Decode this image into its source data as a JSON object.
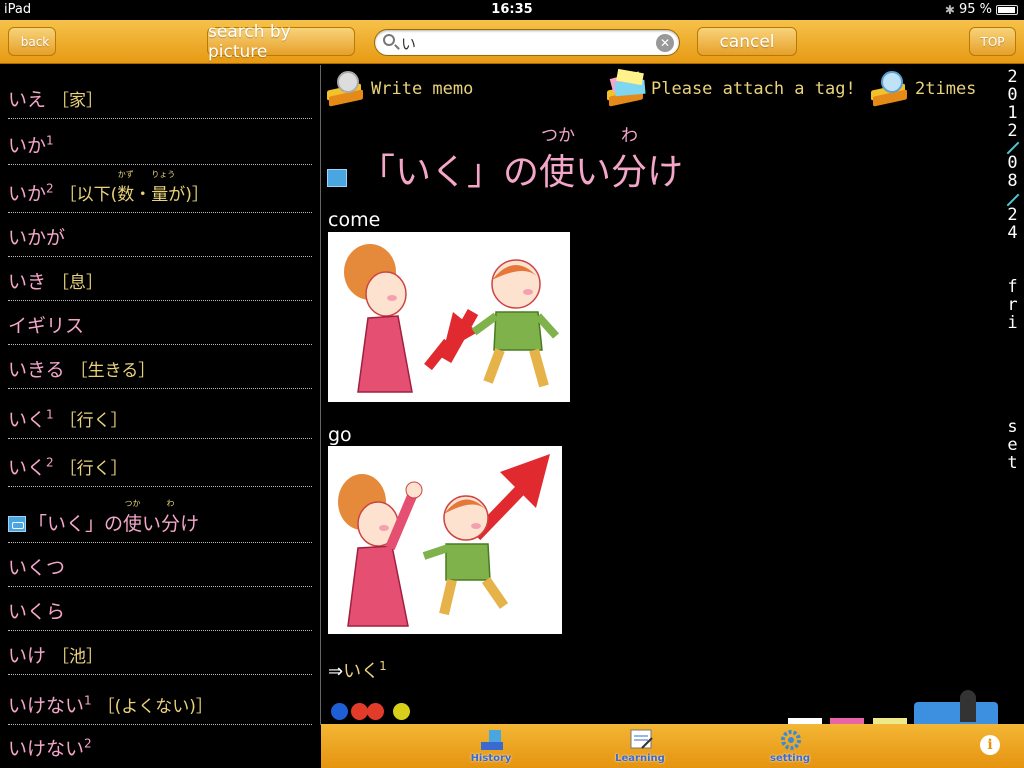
{
  "status_bar": {
    "carrier": "iPad",
    "time": "16:35",
    "battery": "95 %",
    "battery_level": 0.95
  },
  "toolbar": {
    "back_label": "back",
    "search_by_picture_label": "search by picture",
    "search_value": "い",
    "cancel_label": "cancel",
    "top_label": "TOP"
  },
  "word_list": [
    {
      "word": "いえ",
      "sup": "",
      "kanji": "［家］"
    },
    {
      "word": "いか",
      "sup": "1",
      "kanji": ""
    },
    {
      "word": "いか",
      "sup": "2",
      "kanji_pre": "［以下(",
      "kanji_ruby1_base": "数",
      "kanji_ruby1_rt": "かず",
      "kanji_mid": "・",
      "kanji_ruby2_base": "量",
      "kanji_ruby2_rt": "りょう",
      "kanji_post": "が)］"
    },
    {
      "word": "いかが",
      "sup": "",
      "kanji": ""
    },
    {
      "word": "いき",
      "sup": "",
      "kanji": "［息］"
    },
    {
      "word": "イギリス",
      "sup": "",
      "kanji": ""
    },
    {
      "word": "いきる",
      "sup": "",
      "kanji": "［生きる］"
    },
    {
      "word": "いく",
      "sup": "1",
      "kanji": "［行く］"
    },
    {
      "word": "いく",
      "sup": "2",
      "kanji": "［行く］"
    },
    {
      "word_pre": "「いく」の",
      "ruby1_base": "使",
      "ruby1_rt": "つか",
      "word_mid": "い",
      "ruby2_base": "分",
      "ruby2_rt": "わ",
      "word_post": "け"
    },
    {
      "word": "いくつ",
      "sup": "",
      "kanji": ""
    },
    {
      "word": "いくら",
      "sup": "",
      "kanji": ""
    },
    {
      "word": "いけ",
      "sup": "",
      "kanji": "［池］"
    },
    {
      "word": "いけない",
      "sup": "1",
      "kanji": "［(よくない)］"
    },
    {
      "word": "いけない",
      "sup": "2",
      "kanji": ""
    }
  ],
  "detail": {
    "write_memo_label": "Write memo",
    "attach_tag_label": "Please attach a tag!",
    "times_label": "2times",
    "title_pre": "「いく」の",
    "title_ruby1_base": "使",
    "title_ruby1_rt": "つか",
    "title_mid": "い",
    "title_ruby2_base": "分",
    "title_ruby2_rt": "わ",
    "title_post": "け",
    "sense1_label": "come",
    "sense2_label": "go",
    "cross_ref_arrow": "⇒",
    "cross_ref_word": "いく",
    "cross_ref_sup": "1",
    "dot_colors": [
      "#1f5fd6",
      "#e23b2a",
      "#e23b2a",
      "#d8cf1a"
    ]
  },
  "date_column": {
    "chars": [
      "2",
      "0",
      "1",
      "2",
      "0",
      "8",
      "2",
      "4",
      "f",
      "r",
      "i",
      "s",
      "e",
      "t"
    ]
  },
  "tab_bar": {
    "history_label": "History",
    "learning_label": "Learning",
    "setting_label": "setting",
    "info_label": "i"
  },
  "colors": {
    "accent_orange": "#e79a14",
    "pink_text": "#f3a6c8",
    "gold_text": "#e9d27a"
  }
}
